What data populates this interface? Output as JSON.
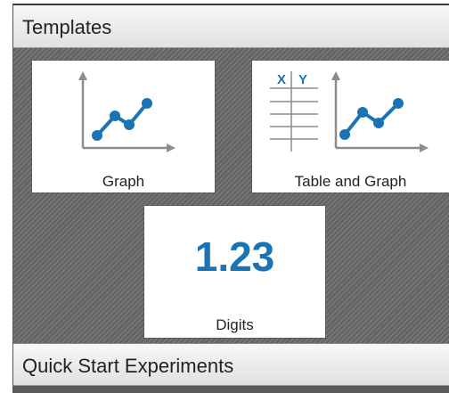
{
  "sections": {
    "templates": {
      "title": "Templates"
    },
    "quick_start": {
      "title": "Quick Start Experiments"
    }
  },
  "templates": [
    {
      "label": "Graph",
      "icon": "graph-icon"
    },
    {
      "label": "Table and Graph",
      "icon": "table-graph-icon",
      "table_headers": [
        "X",
        "Y"
      ]
    },
    {
      "label": "Digits",
      "icon": "digits-icon",
      "value": "1.23"
    }
  ],
  "colors": {
    "accent": "#1a73b5",
    "axis": "#8c8c8c",
    "tile_background": "#ffffff",
    "panel_pattern": "#6d6d6d"
  }
}
